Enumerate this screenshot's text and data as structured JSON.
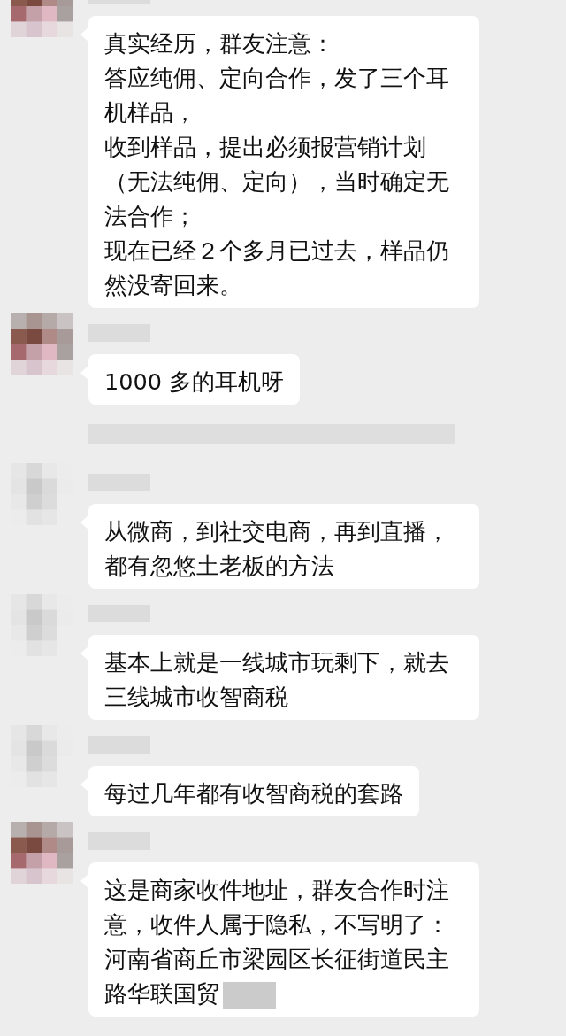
{
  "messages": [
    {
      "kind": "message",
      "avatar": {
        "kind": "photo"
      },
      "paragraphs": [
        "真实经历，群友注意：",
        "答应纯佣、定向合作，发了三个耳机样品，",
        "收到样品，提出必须报营销计划（无法纯佣、定向），当时确定无法合作；",
        "现在已经２个多月已过去，样品仍然没寄回来。"
      ]
    },
    {
      "kind": "message",
      "avatar": {
        "kind": "photo"
      },
      "paragraphs": [
        "1000 多的耳机呀"
      ]
    },
    {
      "kind": "notice"
    },
    {
      "kind": "message",
      "avatar": {
        "kind": "faint"
      },
      "paragraphs": [
        "从微商，到社交电商，再到直播，都有忽悠土老板的方法"
      ]
    },
    {
      "kind": "message",
      "avatar": {
        "kind": "faint"
      },
      "paragraphs": [
        "基本上就是一线城市玩剩下，就去三线城市收智商税"
      ]
    },
    {
      "kind": "message",
      "avatar": {
        "kind": "faint"
      },
      "paragraphs": [
        "每过几年都有收智商税的套路"
      ]
    },
    {
      "kind": "message",
      "avatar": {
        "kind": "photo"
      },
      "paragraphs": [
        "这是商家收件地址，群友合作时注意，收件人属于隐私，不写明了：",
        "河南省商丘市梁园区长征街道民主路华联国贸"
      ],
      "redacted_tail": true
    }
  ]
}
